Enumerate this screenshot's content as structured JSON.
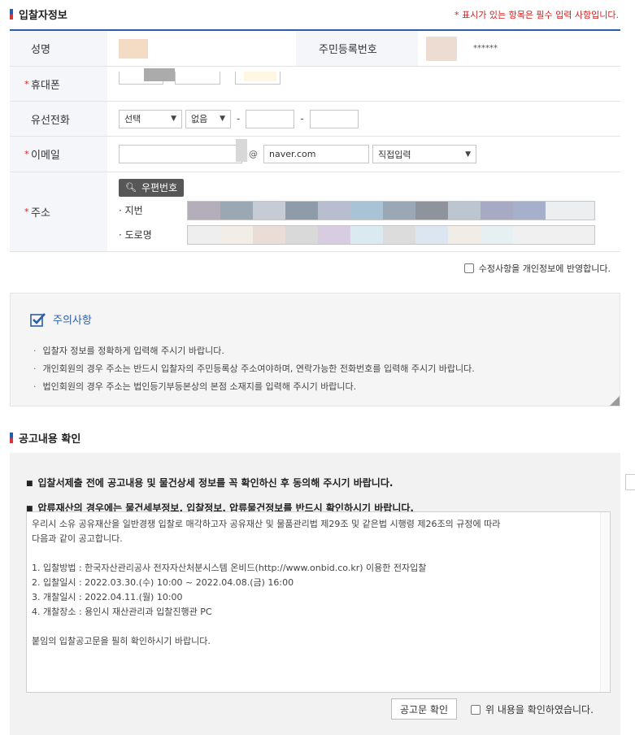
{
  "bidder_section": {
    "title": "입찰자정보",
    "required_note": "* 표시가 있는 항목은 필수 입력 사항입니다."
  },
  "rows": {
    "name": {
      "label": "성명"
    },
    "rrn": {
      "label": "주민등록번호",
      "value": "******"
    },
    "mobile": {
      "label": "휴대폰"
    },
    "landline": {
      "label": "유선전화",
      "carrier_select": "선택",
      "area_select": "없음",
      "sep": "-"
    },
    "email": {
      "label": "이메일",
      "at": "@",
      "domain_value": "naver.com",
      "domain_select": "직접입력"
    },
    "address": {
      "label": "주소",
      "zip_button": "우편번호",
      "jibun_label": "· 지번",
      "road_label": "· 도로명"
    }
  },
  "reflect_label": "수정사항을 개인정보에 반영합니다.",
  "caution": {
    "title": "주의사항",
    "items": [
      "입찰자 정보를 정확하게 입력해 주시기 바랍니다.",
      "개인회원의 경우 주소는 반드시 입찰자의 주민등록상 주소여야하며, 연락가능한 전화번호를 입력해 주시기 바랍니다.",
      "법인회원의 경우 주소는 법인등기부등본상의 본점 소재지를 입력해 주시기 바랍니다."
    ]
  },
  "announcement_section": {
    "title": "공고내용 확인",
    "notes": [
      "입찰서제출 전에 공고내용 및 물건상세 정보를 꼭 확인하신 후 동의해 주시기 바랍니다.",
      "압류재산의 경우에는 물건세부정보, 입찰정보, 압류물건정보를 반드시 확인하시기 바랍니다."
    ],
    "text_lines": [
      "우리시 소유 공유재산을 일반경쟁 입찰로 매각하고자 공유재산 및 물품관리법 제29조 및 같은법 시행령 제26조의 규정에 따라",
      "다음과 같이 공고합니다.",
      "",
      "1. 입찰방법 : 한국자산관리공사 전자자산처분시스템 온비드(http://www.onbid.co.kr) 이용한 전자입찰",
      "2. 입찰일시 : 2022.03.30.(수) 10:00 ~ 2022.04.08.(금) 16:00",
      "3. 개찰일시 : 2022.04.11.(월) 10:00",
      "4. 개찰장소 : 용인시 재산관리과 입찰진행관 PC",
      "",
      "붙임의 입찰공고문을 필히 확인하시기 바랍니다."
    ],
    "confirm_button": "공고문 확인",
    "confirm_check_label": "위 내용을 확인하였습니다."
  },
  "colors": {
    "accent_blue": "#2b5ea8",
    "required_red": "#cc2222",
    "header_bg": "#f4f6f9"
  }
}
